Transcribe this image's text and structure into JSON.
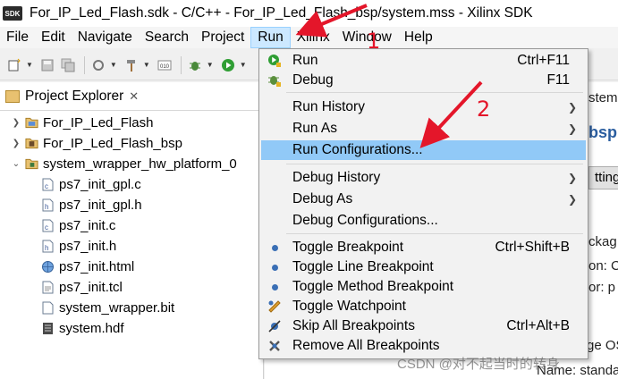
{
  "window": {
    "title": "For_IP_Led_Flash.sdk - C/C++ - For_IP_Led_Flash_bsp/system.mss - Xilinx SDK",
    "app_icon": "SDK"
  },
  "menubar": [
    "File",
    "Edit",
    "Navigate",
    "Search",
    "Project",
    "Run",
    "Xilinx",
    "Window",
    "Help"
  ],
  "explorer": {
    "tab_label": "Project Explorer",
    "close_glyph": "✕",
    "items": [
      {
        "label": "For_IP_Led_Flash",
        "icon": "project-folder-icon"
      },
      {
        "label": "For_IP_Led_Flash_bsp",
        "icon": "bsp-folder-icon"
      },
      {
        "label": "system_wrapper_hw_platform_0",
        "icon": "hw-platform-folder-icon"
      },
      {
        "label": "ps7_init_gpl.c",
        "icon": "c-file-icon"
      },
      {
        "label": "ps7_init_gpl.h",
        "icon": "h-file-icon"
      },
      {
        "label": "ps7_init.c",
        "icon": "c-file-icon"
      },
      {
        "label": "ps7_init.h",
        "icon": "h-file-icon"
      },
      {
        "label": "ps7_init.html",
        "icon": "html-file-icon"
      },
      {
        "label": "ps7_init.tcl",
        "icon": "tcl-file-icon"
      },
      {
        "label": "system_wrapper.bit",
        "icon": "text-file-icon"
      },
      {
        "label": "system.hdf",
        "icon": "hdf-file-icon"
      }
    ]
  },
  "run_menu": {
    "items": [
      {
        "label": "Run",
        "shortcut": "Ctrl+F11",
        "icon": "run-icon",
        "submenu": false,
        "highlighted": false
      },
      {
        "label": "Debug",
        "shortcut": "F11",
        "icon": "debug-icon",
        "submenu": false,
        "highlighted": false
      },
      {
        "label": "Run History",
        "shortcut": "",
        "icon": "",
        "submenu": true,
        "highlighted": false
      },
      {
        "label": "Run As",
        "shortcut": "",
        "icon": "",
        "submenu": true,
        "highlighted": false
      },
      {
        "label": "Run Configurations...",
        "shortcut": "",
        "icon": "",
        "submenu": false,
        "highlighted": true
      },
      {
        "label": "Debug History",
        "shortcut": "",
        "icon": "",
        "submenu": true,
        "highlighted": false
      },
      {
        "label": "Debug As",
        "shortcut": "",
        "icon": "",
        "submenu": true,
        "highlighted": false
      },
      {
        "label": "Debug Configurations...",
        "shortcut": "",
        "icon": "",
        "submenu": false,
        "highlighted": false
      },
      {
        "label": "Toggle Breakpoint",
        "shortcut": "Ctrl+Shift+B",
        "icon": "breakpoint-icon",
        "submenu": false,
        "highlighted": false
      },
      {
        "label": "Toggle Line Breakpoint",
        "shortcut": "",
        "icon": "breakpoint-icon",
        "submenu": false,
        "highlighted": false
      },
      {
        "label": "Toggle Method Breakpoint",
        "shortcut": "",
        "icon": "breakpoint-icon",
        "submenu": false,
        "highlighted": false
      },
      {
        "label": "Toggle Watchpoint",
        "shortcut": "",
        "icon": "watchpoint-icon",
        "submenu": false,
        "highlighted": false
      },
      {
        "label": "Skip All Breakpoints",
        "shortcut": "Ctrl+Alt+B",
        "icon": "skip-breakpoints-icon",
        "submenu": false,
        "highlighted": false
      },
      {
        "label": "Remove All Breakpoints",
        "shortcut": "",
        "icon": "remove-breakpoints-icon",
        "submenu": false,
        "highlighted": false
      }
    ]
  },
  "editor_fragments": {
    "line1": "stem.",
    "heading": "bsp",
    "button": "tting",
    "line2": "ckag",
    "line3": "on:  C",
    "line4": "or:  p",
    "line5": "ge OS",
    "line6": "Name:  standalo"
  },
  "annotations": {
    "step1": "1",
    "step2": "2",
    "accent_color": "#e4162a"
  },
  "watermark": "CSDN @对不起当时的转身"
}
